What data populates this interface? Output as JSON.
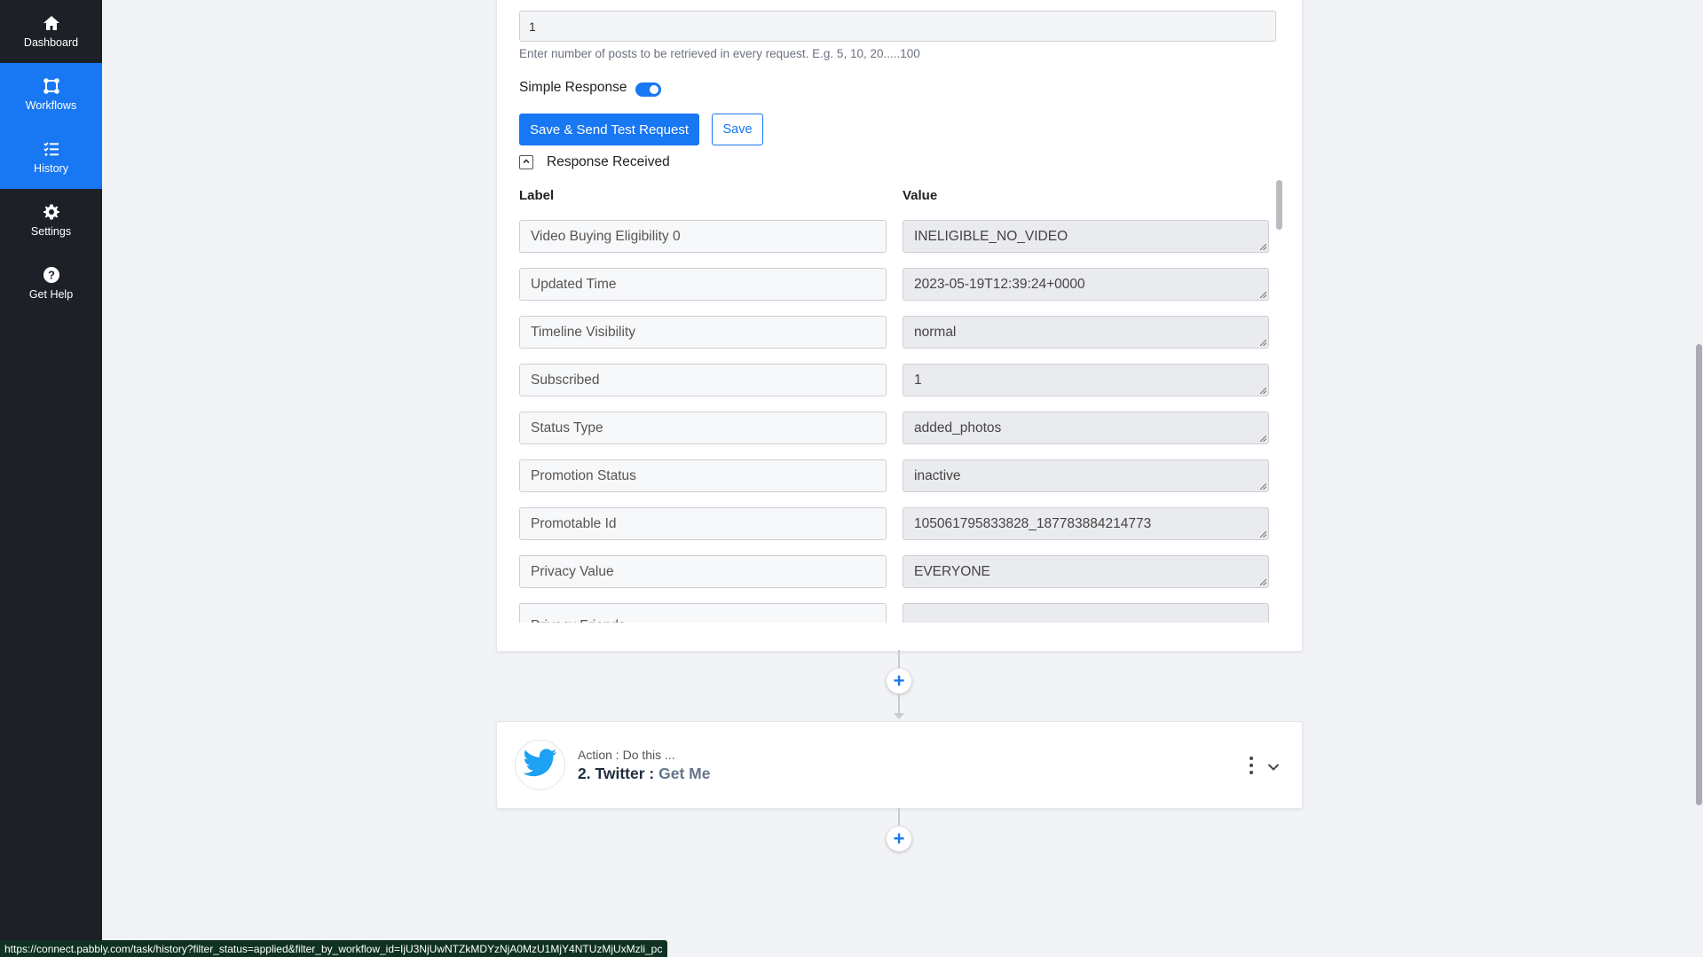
{
  "sidebar": {
    "items": [
      {
        "label": "Dashboard",
        "icon": "home-icon",
        "active": false
      },
      {
        "label": "Workflows",
        "icon": "workflow-icon",
        "active": true
      },
      {
        "label": "History",
        "icon": "history-list-icon",
        "active": true
      },
      {
        "label": "Settings",
        "icon": "gear-icon",
        "active": false
      },
      {
        "label": "Get Help",
        "icon": "question-circle-icon",
        "active": false
      }
    ]
  },
  "trigger": {
    "posts_limit_value": "1",
    "posts_limit_help": "Enter number of posts to be retrieved in every request. E.g. 5, 10, 20.....100",
    "simple_response_label": "Simple Response",
    "simple_response_on": true,
    "save_test_label": "Save & Send Test Request",
    "save_label": "Save",
    "response_received_label": "Response Received",
    "label_header": "Label",
    "value_header": "Value",
    "rows": [
      {
        "label": "Video Buying Eligibility 0",
        "value": "INELIGIBLE_NO_VIDEO"
      },
      {
        "label": "Updated Time",
        "value": "2023-05-19T12:39:24+0000"
      },
      {
        "label": "Timeline Visibility",
        "value": "normal"
      },
      {
        "label": "Subscribed",
        "value": "1"
      },
      {
        "label": "Status Type",
        "value": "added_photos"
      },
      {
        "label": "Promotion Status",
        "value": "inactive"
      },
      {
        "label": "Promotable Id",
        "value": "105061795833828_187783884214773"
      },
      {
        "label": "Privacy Value",
        "value": "EVERYONE"
      },
      {
        "label": "Privacy Friends",
        "value": ""
      }
    ]
  },
  "action": {
    "subtitle": "Action : Do this ...",
    "title": "2. Twitter :",
    "event": "Get Me",
    "icon": "twitter-bird-icon"
  },
  "add_step_symbol": "+",
  "status_url": "https://connect.pabbly.com/task/history?filter_status=applied&filter_by_workflow_id=IjU3NjUwNTZkMDYzNjA0MzU1MjY4NTUzMjUxMzli_pc",
  "colors": {
    "accent": "#1877f2",
    "sidebar_bg": "#1d2127",
    "twitter": "#1da1f2"
  }
}
